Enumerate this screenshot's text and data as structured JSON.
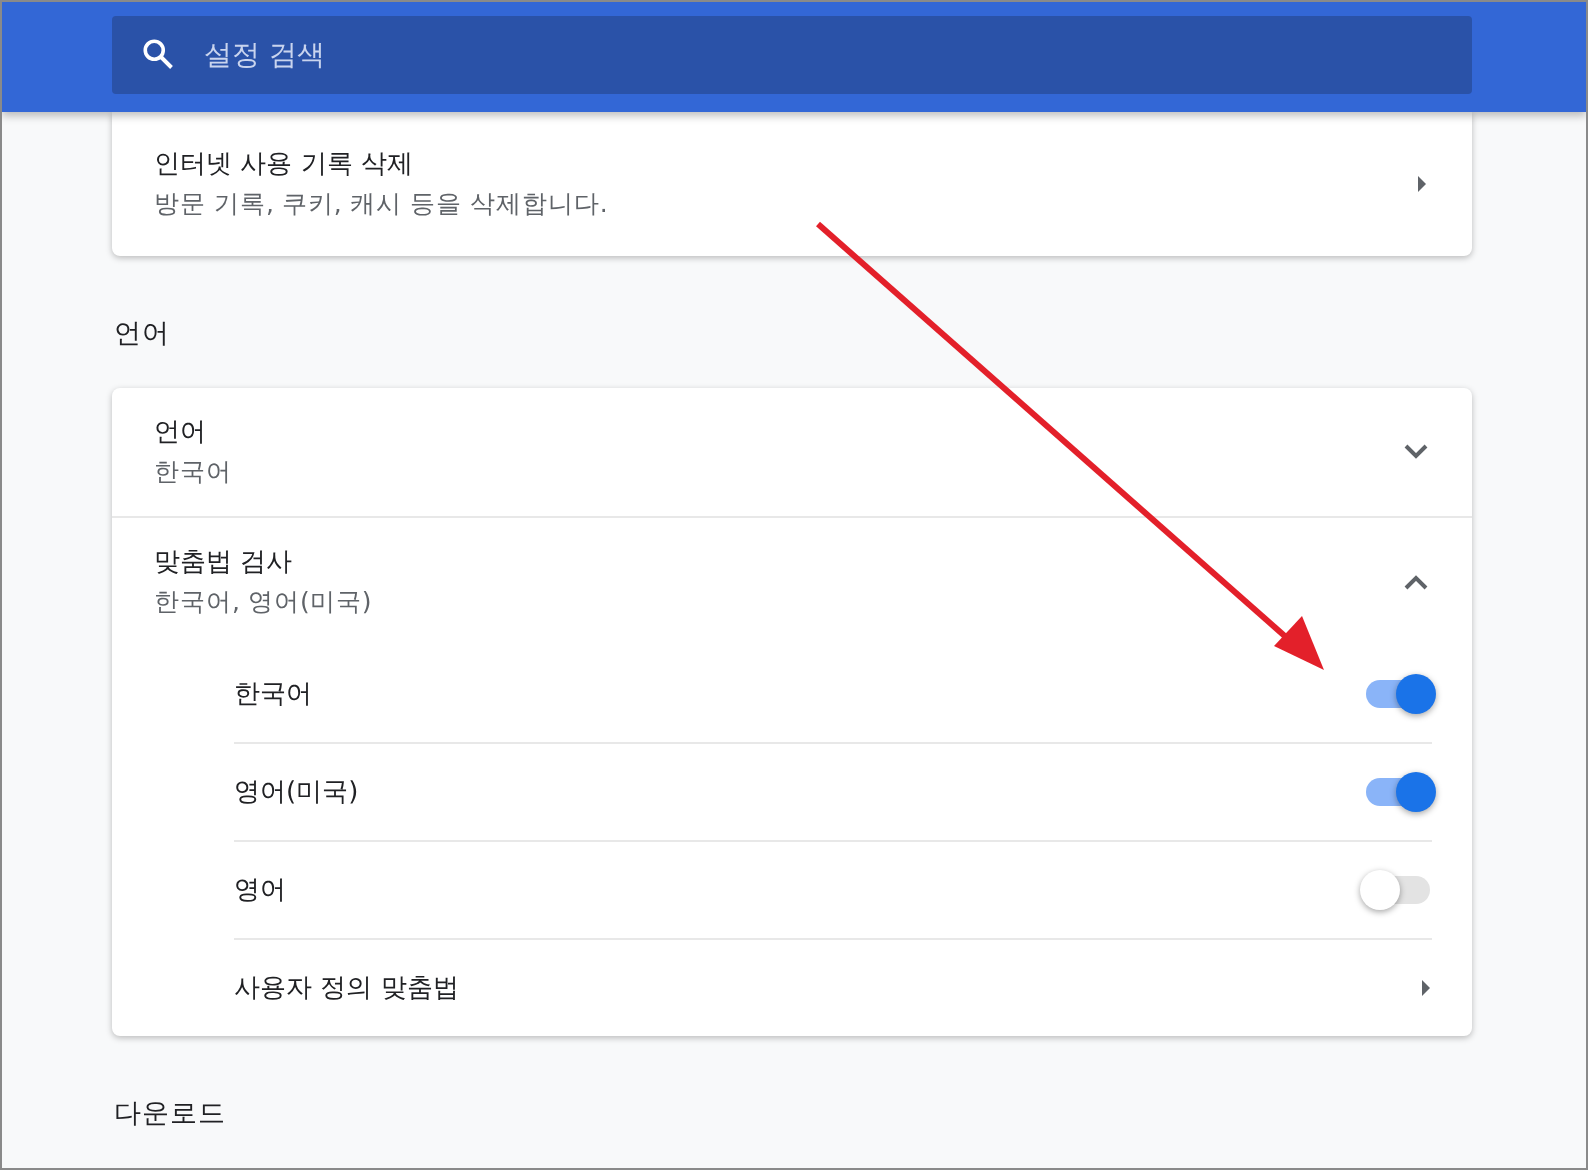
{
  "search": {
    "placeholder": "설정 검색"
  },
  "history_card": {
    "title": "인터넷 사용 기록 삭제",
    "subtitle": "방문 기록, 쿠키, 캐시 등을 삭제합니다."
  },
  "sections": [
    {
      "title": "언어",
      "rows": [
        {
          "title": "언어",
          "subtitle": "한국어",
          "expanded": false
        },
        {
          "title": "맞춤법 검사",
          "subtitle": "한국어, 영어(미국)",
          "expanded": true,
          "children": [
            {
              "kind": "toggle",
              "label": "한국어",
              "on": true
            },
            {
              "kind": "toggle",
              "label": "영어(미국)",
              "on": true
            },
            {
              "kind": "toggle",
              "label": "영어",
              "on": false
            },
            {
              "kind": "link",
              "label": "사용자 정의 맞춤법"
            }
          ]
        }
      ]
    },
    {
      "title": "다운로드"
    }
  ]
}
